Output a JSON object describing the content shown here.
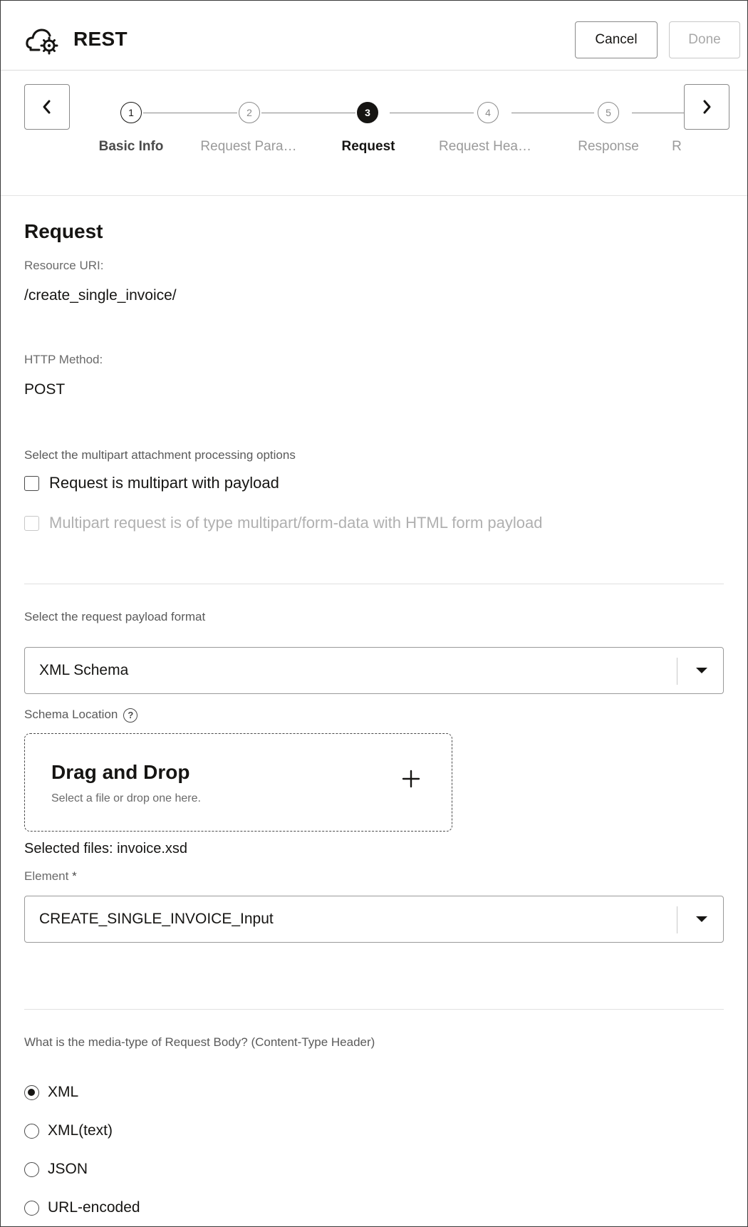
{
  "header": {
    "title": "REST",
    "cancel_label": "Cancel",
    "done_label": "Done",
    "logo_icon": "cloud-gear-icon"
  },
  "train": {
    "steps": [
      {
        "number": "1",
        "label": "Basic Info",
        "state": "done"
      },
      {
        "number": "2",
        "label": "Request Para…",
        "state": "pending"
      },
      {
        "number": "3",
        "label": "Request",
        "state": "active"
      },
      {
        "number": "4",
        "label": "Request Hea…",
        "state": "pending"
      },
      {
        "number": "5",
        "label": "Response",
        "state": "pending"
      },
      {
        "number": "",
        "label": "R",
        "state": "pending"
      }
    ]
  },
  "request": {
    "section_title": "Request",
    "resource_uri_label": "Resource URI:",
    "resource_uri_value": "/create_single_invoice/",
    "http_method_label": "HTTP Method:",
    "http_method_value": "POST",
    "multipart_helper": "Select the multipart attachment processing options",
    "multipart_with_payload": "Request is multipart with payload",
    "multipart_form_data": "Multipart request is of type multipart/form-data with HTML form payload",
    "payload_format_helper": "Select the request payload format",
    "payload_format_value": "XML Schema",
    "schema_location_label": "Schema Location",
    "dropzone_title": "Drag and Drop",
    "dropzone_subtitle": "Select a file or drop one here.",
    "selected_files": "Selected files: invoice.xsd",
    "element_label": "Element",
    "element_required_marker": "*",
    "element_value": "CREATE_SINGLE_INVOICE_Input",
    "media_type_question": "What is the media-type of Request Body? (Content-Type Header)",
    "media_types": [
      {
        "label": "XML",
        "checked": true
      },
      {
        "label": "XML(text)",
        "checked": false
      },
      {
        "label": "JSON",
        "checked": false
      },
      {
        "label": "URL-encoded",
        "checked": false
      }
    ]
  }
}
